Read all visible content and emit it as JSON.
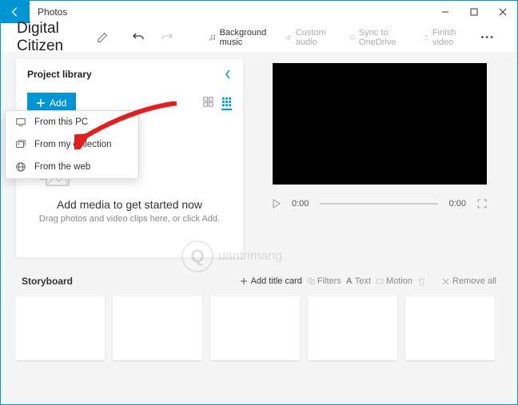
{
  "titlebar": {
    "app_name": "Photos"
  },
  "project": {
    "name": "Digital Citizen"
  },
  "toolbar": {
    "bg_music": "Background music",
    "custom_audio": "Custom audio",
    "sync": "Sync to OneDrive",
    "finish": "Finish video"
  },
  "library": {
    "title": "Project library",
    "add_label": "Add",
    "empty_title": "Add media to get started now",
    "empty_sub": "Drag photos and video clips here, or click Add."
  },
  "add_menu": {
    "from_pc": "From this PC",
    "from_collection": "From my collection",
    "from_web": "From the web"
  },
  "player": {
    "cur": "0:00",
    "dur": "0:00"
  },
  "storyboard": {
    "title": "Storyboard",
    "add_title_card": "Add title card",
    "filters": "Filters",
    "text": "Text",
    "motion": "Motion",
    "remove_all": "Remove all"
  },
  "watermark": {
    "text": "uantrimang"
  }
}
